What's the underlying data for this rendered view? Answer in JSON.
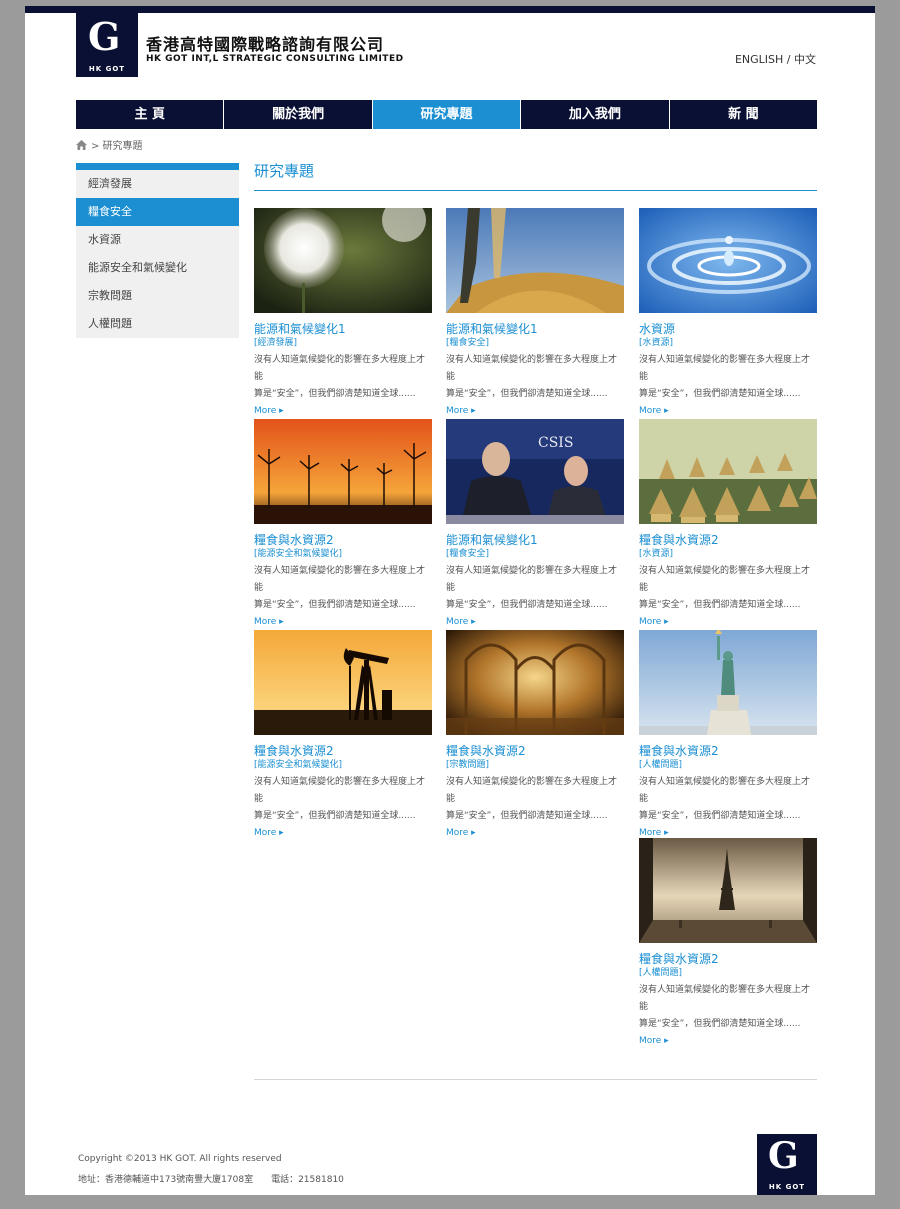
{
  "brand": {
    "logo_mark": "G",
    "logo_text": "HK  GOT",
    "name_cn": "香港高特國際戰略諮詢有限公司",
    "name_en": "HK GOT INT,L STRATEGIC CONSULTING LIMITED"
  },
  "lang": "ENGLISH / 中文",
  "nav": [
    "主 頁",
    "關於我們",
    "研究專題",
    "加入我們",
    "新 聞"
  ],
  "nav_active": "研究專題",
  "breadcrumb": "> 研究專題",
  "sidebar": [
    "經濟發展",
    "糧食安全",
    "水資源",
    "能源安全和氣候變化",
    "宗教問題",
    "人權問題"
  ],
  "sidebar_active": "糧食安全",
  "section_title": "研究專題",
  "cards": [
    {
      "title": "能源和氣候變化1",
      "category": "[經濟發展]",
      "desc1": "沒有人知道氣候變化的影響在多大程度上才能",
      "desc2": "算是“安全”，但我們卻清楚知道全球......",
      "more": "More ▸",
      "image": "dandelion"
    },
    {
      "title": "能源和氣候變化1",
      "category": "[糧食安全]",
      "desc1": "沒有人知道氣候變化的影響在多大程度上才能",
      "desc2": "算是“安全”，但我們卻清楚知道全球......",
      "more": "More ▸",
      "image": "grain"
    },
    {
      "title": "水資源",
      "category": "[水資源]",
      "desc1": "沒有人知道氣候變化的影響在多大程度上才能",
      "desc2": "算是“安全”，但我們卻清楚知道全球......",
      "more": "More ▸",
      "image": "water-drop"
    },
    {
      "title": "糧食與水資源2",
      "category": "[能源安全和氣候變化]",
      "desc1": "沒有人知道氣候變化的影響在多大程度上才能",
      "desc2": "算是“安全”，但我們卻清楚知道全球......",
      "more": "More ▸",
      "image": "wind-turbines"
    },
    {
      "title": "能源和氣候變化1",
      "category": "[糧食安全]",
      "desc1": "沒有人知道氣候變化的影響在多大程度上才能",
      "desc2": "算是“安全”，但我們卻清楚知道全球......",
      "more": "More ▸",
      "image": "conference",
      "img_text": "CSIS"
    },
    {
      "title": "糧食與水資源2",
      "category": "[水資源]",
      "desc1": "沒有人知道氣候變化的影響在多大程度上才能",
      "desc2": "算是“安全”，但我們卻清楚知道全球......",
      "more": "More ▸",
      "image": "haystacks"
    },
    {
      "title": "糧食與水資源2",
      "category": "[能源安全和氣候變化]",
      "desc1": "沒有人知道氣候變化的影響在多大程度上才能",
      "desc2": "算是“安全”，但我們卻清楚知道全球......",
      "more": "More ▸",
      "image": "oil-pump"
    },
    {
      "title": "糧食與水資源2",
      "category": "[宗教問題]",
      "desc1": "沒有人知道氣候變化的影響在多大程度上才能",
      "desc2": "算是“安全”，但我們卻清楚知道全球......",
      "more": "More ▸",
      "image": "cathedral"
    },
    {
      "title": "糧食與水資源2",
      "category": "[人權問題]",
      "desc1": "沒有人知道氣候變化的影響在多大程度上才能",
      "desc2": "算是“安全”，但我們卻清楚知道全球......",
      "more": "More ▸",
      "image": "statue-of-liberty"
    },
    {
      "title": "糧食與水資源2",
      "category": "[人權問題]",
      "desc1": "沒有人知道氣候變化的影響在多大程度上才能",
      "desc2": "算是“安全”，但我們卻清楚知道全球......",
      "more": "More ▸",
      "image": "eiffel-tower"
    }
  ],
  "footer": {
    "copyright": "Copyright ©2013 HK GOT. All rights reserved",
    "address": "地址：香港德輔道中173號南豐大廈1708室　　電話：21581810"
  },
  "colors": {
    "navy": "#0a1033",
    "accent": "#1b8fd2",
    "sidebar_bg": "#f0f0f0"
  }
}
